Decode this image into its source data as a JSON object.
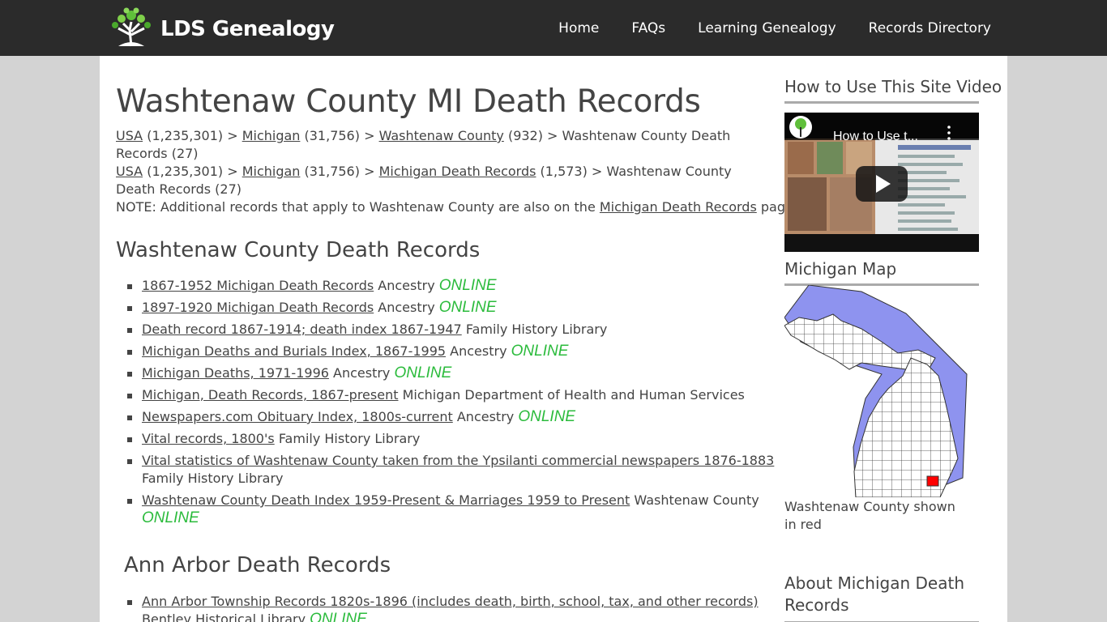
{
  "header": {
    "logo_text": "LDS Genealogy",
    "nav": [
      "Home",
      "FAQs",
      "Learning Genealogy",
      "Records Directory"
    ]
  },
  "page": {
    "title": "Washtenaw County MI Death Records",
    "breadcrumbs": [
      {
        "items": [
          {
            "link": "USA",
            "count": " (1,235,301) > "
          },
          {
            "link": "Michigan",
            "count": " (31,756) > "
          },
          {
            "link": "Washtenaw County",
            "count": " (932) > Washtenaw County Death Records (27)"
          }
        ]
      },
      {
        "items": [
          {
            "link": "USA",
            "count": " (1,235,301) > "
          },
          {
            "link": "Michigan",
            "count": " (31,756) > "
          },
          {
            "link": "Michigan Death Records",
            "count": " (1,573) > Washtenaw County Death Records (27)"
          }
        ]
      }
    ],
    "note": {
      "prefix": "NOTE: Additional records that apply to Washtenaw County are also on the ",
      "link": "Michigan Death Records",
      "suffix": " page."
    }
  },
  "sections": [
    {
      "heading": "Washtenaw County Death Records",
      "records": [
        {
          "link": "1867-1952 Michigan Death Records",
          "source": "Ancestry",
          "online": "ONLINE"
        },
        {
          "link": "1897-1920 Michigan Death Records",
          "source": "Ancestry",
          "online": "ONLINE"
        },
        {
          "link": "Death record 1867-1914; death index 1867-1947",
          "source": "Family History Library",
          "online": ""
        },
        {
          "link": "Michigan Deaths and Burials Index, 1867-1995",
          "source": "Ancestry",
          "online": "ONLINE"
        },
        {
          "link": "Michigan Deaths, 1971-1996",
          "source": "Ancestry",
          "online": "ONLINE"
        },
        {
          "link": "Michigan, Death Records, 1867-present",
          "source": "Michigan Department of Health and Human Services",
          "online": ""
        },
        {
          "link": "Newspapers.com Obituary Index, 1800s-current",
          "source": "Ancestry",
          "online": "ONLINE"
        },
        {
          "link": "Vital records, 1800's",
          "source": "Family History Library",
          "online": ""
        },
        {
          "link": "Vital statistics of Washtenaw County taken from the Ypsilanti commercial newspapers 1876-1883",
          "source": "Family History Library",
          "online": ""
        },
        {
          "link": "Washtenaw County Death Index 1959-Present & Marriages 1959 to Present",
          "source": "Washtenaw County",
          "online": "ONLINE"
        }
      ]
    },
    {
      "heading": "Ann Arbor Death Records",
      "records": [
        {
          "link": "Ann Arbor Township Records 1820s-1896 (includes death, birth, school, tax, and other records)",
          "source": "Bentley Historical Library",
          "online": "ONLINE"
        }
      ]
    }
  ],
  "sidebar": {
    "video_title": "How to Use This Site Video",
    "video_caption": "How to Use t...",
    "map_title": "Michigan Map",
    "map_caption": "Washtenaw County shown in red",
    "about_title": "About Michigan Death Records"
  },
  "colors": {
    "header_bg": "#2b2b2b",
    "online_green": "#2bbb3c",
    "lake_blue": "#8e93ef",
    "highlight_red": "#ff0000"
  }
}
